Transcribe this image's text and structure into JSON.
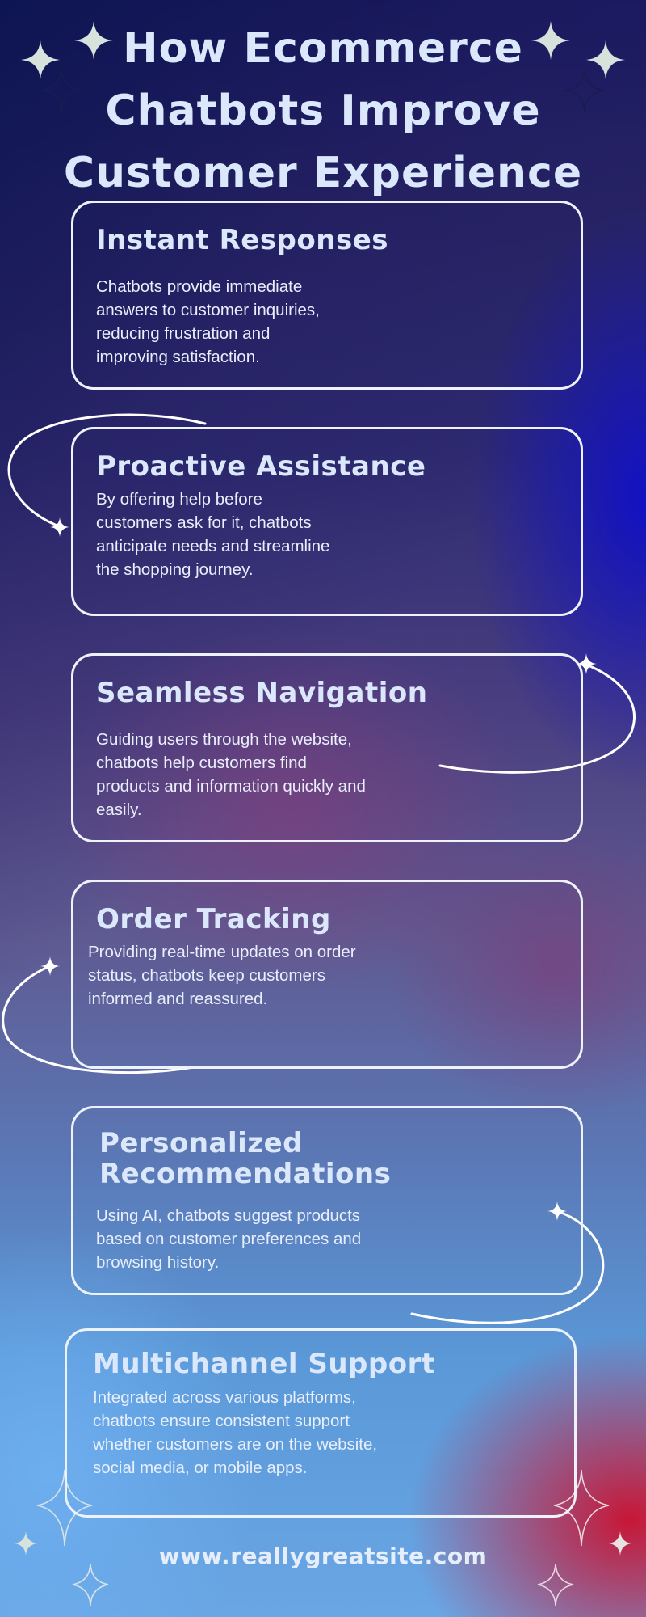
{
  "title": {
    "line1": "How Ecommerce",
    "line2": "Chatbots Improve",
    "line3": "Customer Experience"
  },
  "cards": [
    {
      "heading": "Instant Responses",
      "body_lines": [
        "Chatbots provide immediate",
        "answers to customer inquiries,",
        "reducing frustration and",
        "improving satisfaction."
      ]
    },
    {
      "heading": "Proactive Assistance",
      "body_lines": [
        "By offering help before",
        "customers ask for it, chatbots",
        "anticipate needs and streamline",
        "the shopping journey."
      ]
    },
    {
      "heading": "Seamless Navigation",
      "body_lines": [
        "Guiding users through the website,",
        "chatbots help customers find",
        "products and information quickly and",
        "easily."
      ]
    },
    {
      "heading": "Order Tracking",
      "body_lines": [
        "Providing real-time updates on order",
        "status, chatbots keep customers",
        "informed and reassured."
      ]
    },
    {
      "heading_lines": [
        "Personalized",
        "Recommendations"
      ],
      "body_lines": [
        "Using AI, chatbots suggest products",
        "based on customer preferences and",
        "browsing history."
      ]
    },
    {
      "heading": "Multichannel Support",
      "body_lines": [
        "Integrated across various platforms,",
        "chatbots ensure consistent support",
        "whether customers are on the website,",
        "social media, or mobile apps."
      ]
    }
  ],
  "footer": {
    "url": "www.reallygreatsite.com"
  },
  "colors": {
    "text": "#dbe8fb",
    "card_border": "#eef2fb",
    "sparkle": "#d8e2dc",
    "accent_red": "#cd0f2d",
    "accent_blue": "#1010c8"
  },
  "icons": [
    "sparkle-icon",
    "sparkle-outline-icon",
    "curved-arrow-icon"
  ]
}
